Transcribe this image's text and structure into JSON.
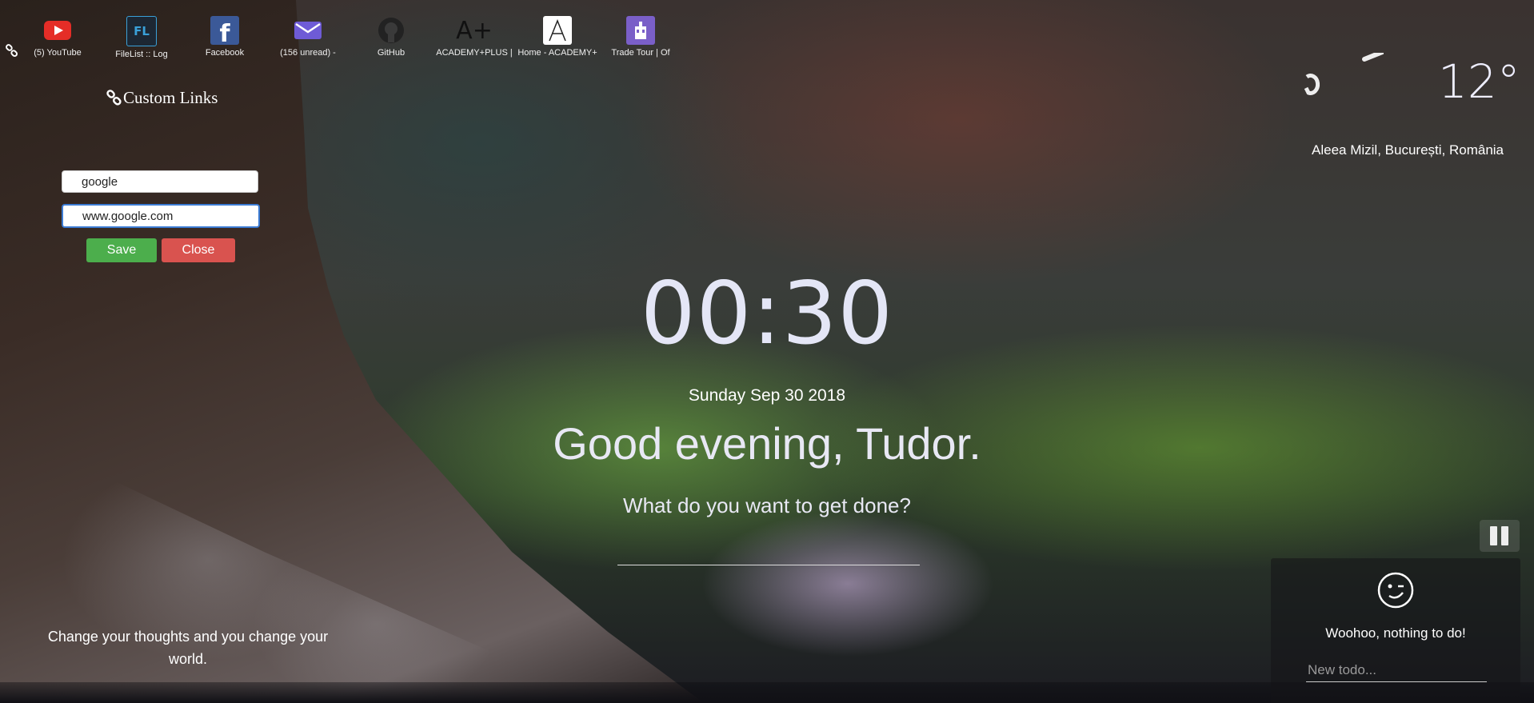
{
  "bookmarks": [
    {
      "label": "(5) YouTube",
      "icon": "youtube-icon"
    },
    {
      "label": "FileList :: Log",
      "icon": "filelist-icon"
    },
    {
      "label": "Facebook",
      "icon": "facebook-icon"
    },
    {
      "label": "(156 unread) -",
      "icon": "mail-icon"
    },
    {
      "label": "GitHub",
      "icon": "github-icon"
    },
    {
      "label": "ACADEMY+PLUS |",
      "icon": "academy-plus-icon"
    },
    {
      "label": "Home - ACADEMY+",
      "icon": "academy-home-icon"
    },
    {
      "label": "Trade Tour | Of",
      "icon": "trade-tour-icon"
    }
  ],
  "panel": {
    "title": "Custom Links",
    "name_value": "google",
    "url_value": "www.google.com",
    "save_label": "Save",
    "close_label": "Close"
  },
  "weather": {
    "temperature": "12°",
    "location": "Aleea Mizil, București, România"
  },
  "center": {
    "time": "00:30",
    "date": "Sunday Sep 30 2018",
    "greeting": "Good evening, Tudor.",
    "question": "What do you want to get done?"
  },
  "quote": "Change your thoughts and you change your world.",
  "todo": {
    "empty_text": "Woohoo, nothing to do!",
    "placeholder": "New todo..."
  },
  "colors": {
    "save": "#4cae4c",
    "close": "#d9534f",
    "youtube": "#e52d27",
    "facebook": "#3b5998",
    "mail": "#6e5bd6",
    "trade_tour": "#7a5fc8"
  }
}
